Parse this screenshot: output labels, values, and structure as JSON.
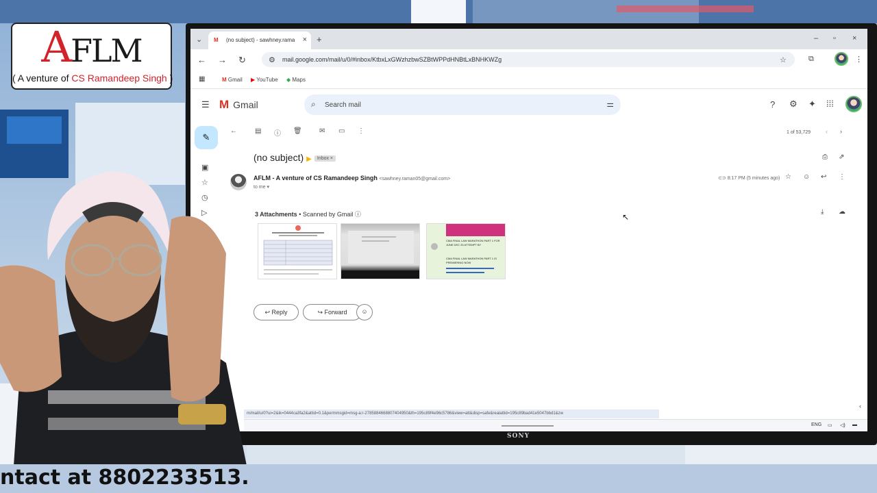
{
  "logo": {
    "brand": "AFLM",
    "tagline_prefix": "( A venture of ",
    "tagline_name": "CS Ramandeep Singh",
    "tagline_suffix": " )"
  },
  "browser": {
    "tab_title": "(no subject) - sawhney.rama",
    "url": "mail.google.com/mail/u/0/#inbox/KtbxLxGWzhzbwSZBtWPPdHNBtLxBNHKWZg",
    "bookmarks": [
      "Gmail",
      "YouTube",
      "Maps"
    ]
  },
  "gmail": {
    "app_name": "Gmail",
    "search_placeholder": "Search mail",
    "pager": "1 of 53,729",
    "subject": "(no subject)",
    "label": "Inbox ×",
    "sender_name": "AFLM - A venture of CS Ramandeep Singh",
    "sender_email": "<sawhney.raman05@gmail.com>",
    "recipient": "to me ▾",
    "time": "8:17 PM (5 minutes ago)",
    "attachments_count": "3 Attachments",
    "scanned": "• Scanned by Gmail",
    "reply_label": "Reply",
    "forward_label": "Forward",
    "status_url": "m/mail/u/0?ui=2&ik=0444ca3fa2&attid=0.1&permmsgid=msg-a:r-2785884668807404950&th=195c89f4e96c5786&view=att&disp=safe&realattid=195c89bad41e5047bbd1&zw",
    "taskbar_lang": "ENG",
    "thumb3_lines": [
      "CMA FINAL LAW MARATHON PART 1 FOR JUNE DEC 25 ATTEMPT BY",
      "CMA FINAL LAW MARATHON PART 1 IS PREMIERING NOW"
    ]
  },
  "monitor_brand": "SONY",
  "ticker": "ntact at 8802233513.",
  "colors": {
    "gmail_red": "#d93025",
    "aflm_red": "#d2222a",
    "compose_blue": "#c2e7ff",
    "ticker_bg": "#b6c9e0"
  }
}
